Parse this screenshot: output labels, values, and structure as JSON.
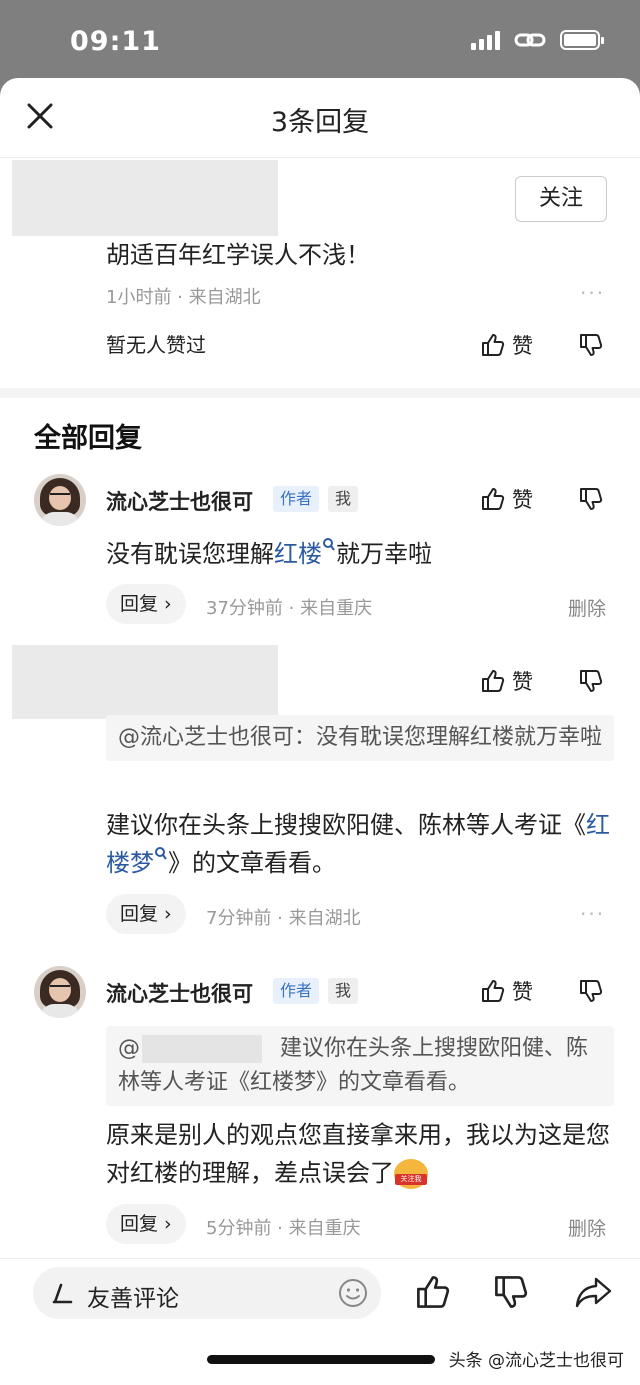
{
  "status_bar": {
    "time": "09:11"
  },
  "header": {
    "title": "3条回复"
  },
  "root_comment": {
    "follow_label": "关注",
    "text": "胡适百年红学误人不浅！",
    "meta": "1小时前 · 来自湖北",
    "likes_text": "暂无人赞过",
    "like_label": "赞"
  },
  "section_title": "全部回复",
  "replies": [
    {
      "username": "流心芝士也很可",
      "badge_author": "作者",
      "badge_me": "我",
      "like_label": "赞",
      "text_before": "没有耽误您理解",
      "text_link": "红楼",
      "text_after": "就万幸啦",
      "reply_label": "回复",
      "meta": "37分钟前 · 来自重庆",
      "delete_label": "删除"
    },
    {
      "like_label": "赞",
      "quote": "@流心芝士也很可：没有耽误您理解红楼就万幸啦",
      "text_before": "建议你在头条上搜搜欧阳健、陈林等人考证《",
      "text_link": "红楼梦",
      "text_after": "》的文章看看。",
      "reply_label": "回复",
      "meta": "7分钟前 · 来自湖北"
    },
    {
      "username": "流心芝士也很可",
      "badge_author": "作者",
      "badge_me": "我",
      "like_label": "赞",
      "quote_prefix": "@",
      "quote": "建议你在头条上搜搜欧阳健、陈林等人考证《红楼梦》的文章看看。",
      "text": "原来是别人的观点您直接拿来用，我以为这是您对红楼的理解，差点误会了",
      "emoji_text": "关注我",
      "reply_label": "回复",
      "meta": "5分钟前 · 来自重庆",
      "delete_label": "删除"
    }
  ],
  "bottom_bar": {
    "placeholder": "友善评论"
  },
  "watermark": "头条 @流心芝士也很可"
}
